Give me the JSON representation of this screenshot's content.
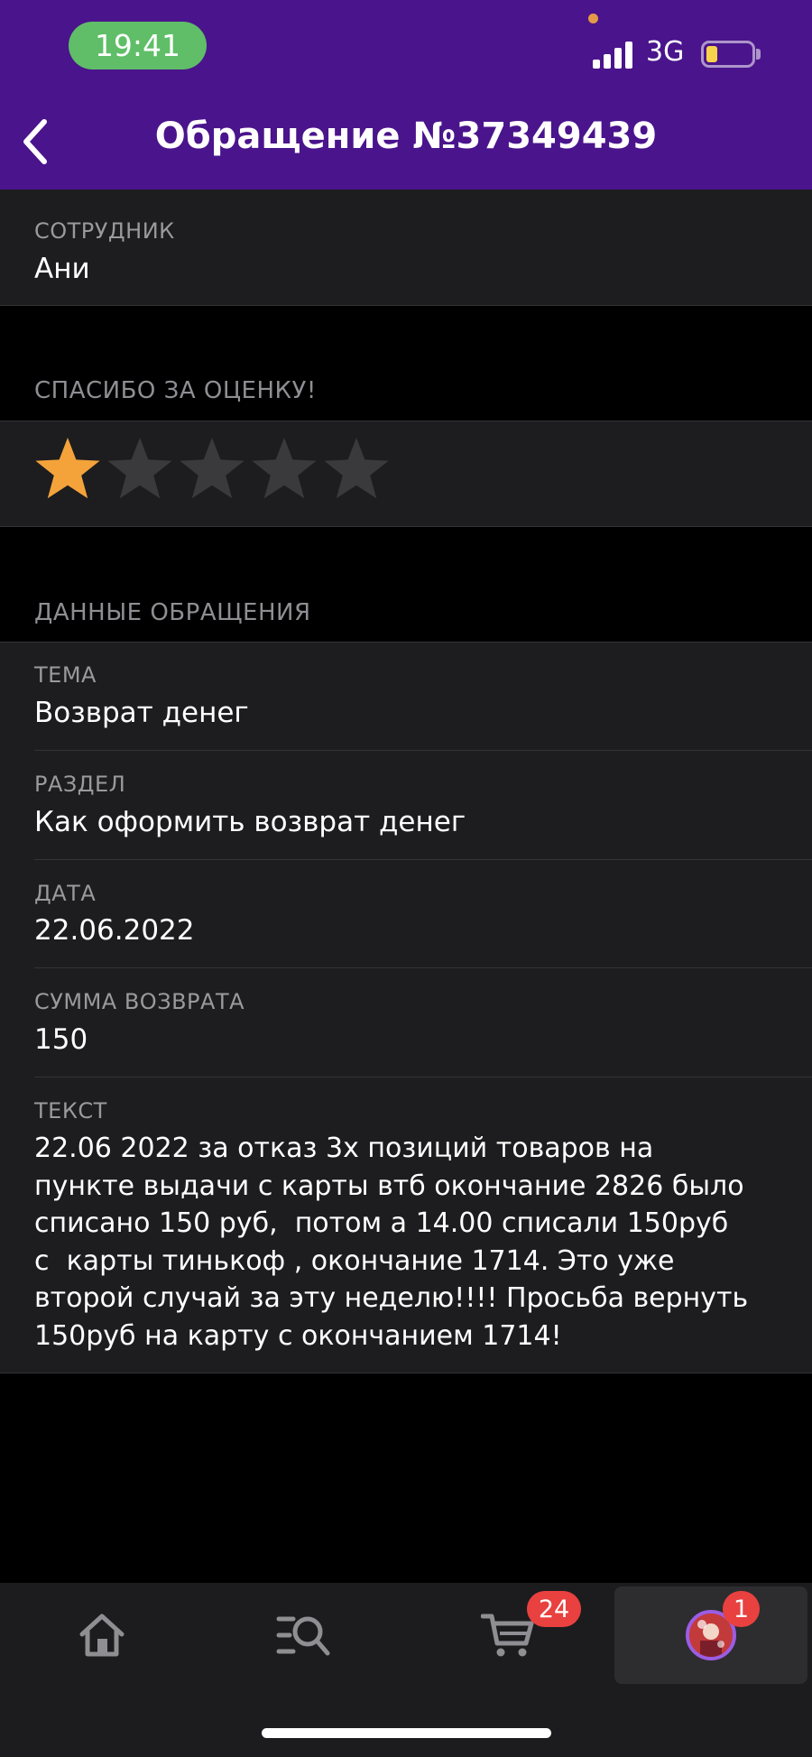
{
  "status_bar": {
    "time": "19:41",
    "network": "3G",
    "battery_level": 0.25
  },
  "header": {
    "title": "Обращение №37349439"
  },
  "employee": {
    "label": "СОТРУДНИК",
    "value": "Ани"
  },
  "rating": {
    "title": "СПАСИБО ЗА ОЦЕНКУ!",
    "value": 1,
    "max": 5,
    "filled_color": "#f4a33b",
    "empty_color": "#3a3a3c"
  },
  "details": {
    "title": "ДАННЫЕ ОБРАЩЕНИЯ",
    "topic_label": "ТЕМА",
    "topic_value": "Возврат денег",
    "section_label": "РАЗДЕЛ",
    "section_value": "Как оформить возврат денег",
    "date_label": "ДАТА",
    "date_value": "22.06.2022",
    "refund_label": "СУММА ВОЗВРАТА",
    "refund_value": "150",
    "text_label": "ТЕКСТ",
    "text_value": "22.06 2022 за отказ 3х позиций товаров на\nпункте выдачи с карты втб окончание 2826 было\nсписано 150 руб,  потом а 14.00 списали 150руб\nс  карты тинькоф , окончание 1714. Это уже\nвторой случай за эту неделю!!!! Просьба вернуть\n150руб на карту с окончанием 1714!"
  },
  "tabbar": {
    "icons": [
      "home-icon",
      "catalog-search-icon",
      "cart-icon",
      "profile-avatar"
    ],
    "cart_badge": "24",
    "profile_badge": "1",
    "badge_color": "#e8413f"
  },
  "colors": {
    "header": "#4a148c",
    "time_pill": "#5fbe67"
  }
}
